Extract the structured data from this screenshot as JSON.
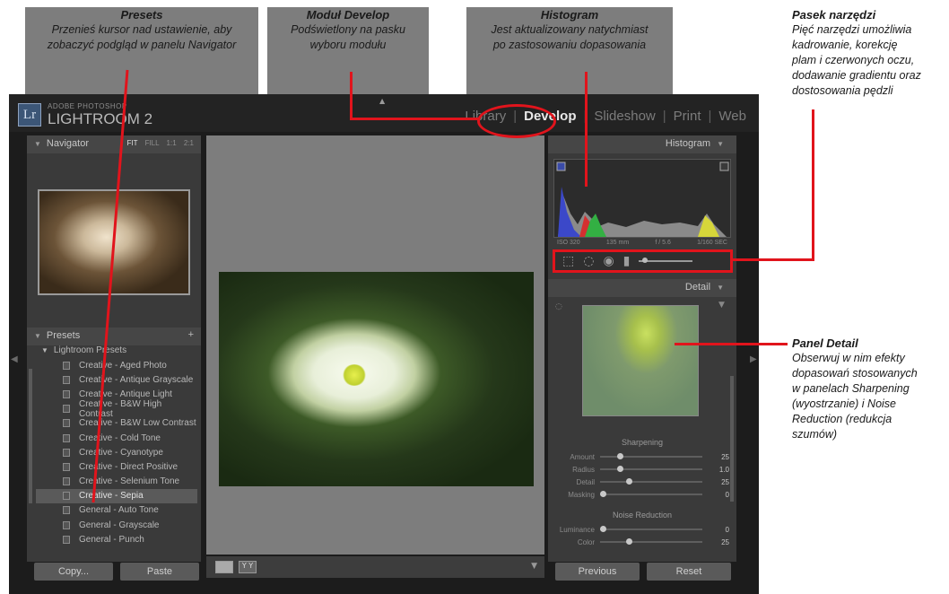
{
  "annotations": {
    "presets": {
      "title": "Presets",
      "line1": "Przenieś kursor nad ustawienie, aby",
      "line2": "zobaczyć podgląd w panelu Navigator"
    },
    "develop": {
      "title": "Moduł Develop",
      "line1": "Podświetlony na pasku",
      "line2": "wyboru modułu"
    },
    "histogram": {
      "title": "Histogram",
      "line1": "Jest aktualizowany natychmiast",
      "line2": "po zastosowaniu dopasowania"
    },
    "toolbar": {
      "title": "Pasek narzędzi",
      "line1": "Pięć narzędzi umożliwia",
      "line2": "kadrowanie, korekcję",
      "line3": "plam i czerwonych oczu,",
      "line4": "dodawanie gradientu oraz",
      "line5": "dostosowania pędzli"
    },
    "detail": {
      "title": "Panel Detail",
      "line1": "Obserwuj w nim efekty",
      "line2": "dopasowań stosowanych",
      "line3": "w panelach Sharpening",
      "line4": "(wyostrzanie) i Noise",
      "line5": "Reduction (redukcja",
      "line6": "szumów)"
    }
  },
  "app": {
    "logo": "Lr",
    "brand_small": "ADOBE PHOTOSHOP",
    "brand_large": "LIGHTROOM 2",
    "modules": [
      "Library",
      "Develop",
      "Slideshow",
      "Print",
      "Web"
    ],
    "active_module": "Develop"
  },
  "navigator": {
    "title": "Navigator",
    "options": [
      "FIT",
      "FILL",
      "1:1",
      "2:1"
    ]
  },
  "presets": {
    "title": "Presets",
    "add": "+",
    "group": "Lightroom Presets",
    "items": [
      "Creative - Aged Photo",
      "Creative - Antique Grayscale",
      "Creative - Antique Light",
      "Creative - B&W High Contrast",
      "Creative - B&W Low Contrast",
      "Creative - Cold Tone",
      "Creative - Cyanotype",
      "Creative - Direct Positive",
      "Creative - Selenium Tone",
      "Creative - Sepia",
      "General - Auto Tone",
      "General - Grayscale",
      "General - Punch"
    ],
    "selected_index": 9
  },
  "histogram": {
    "title": "Histogram",
    "info": [
      "ISO 320",
      "135 mm",
      "f / 5.6",
      "1/160 SEC"
    ]
  },
  "detail": {
    "title": "Detail",
    "sharpening_title": "Sharpening",
    "sharpening": [
      {
        "label": "Amount",
        "value": "25",
        "pos": 0.17
      },
      {
        "label": "Radius",
        "value": "1.0",
        "pos": 0.17
      },
      {
        "label": "Detail",
        "value": "25",
        "pos": 0.25
      },
      {
        "label": "Masking",
        "value": "0",
        "pos": 0.0
      }
    ],
    "noise_title": "Noise Reduction",
    "noise": [
      {
        "label": "Luminance",
        "value": "0",
        "pos": 0.0
      },
      {
        "label": "Color",
        "value": "25",
        "pos": 0.25
      }
    ]
  },
  "buttons": {
    "copy": "Copy...",
    "paste": "Paste",
    "previous": "Previous",
    "reset": "Reset"
  },
  "colors": {
    "annotation_red": "#e1141c"
  }
}
